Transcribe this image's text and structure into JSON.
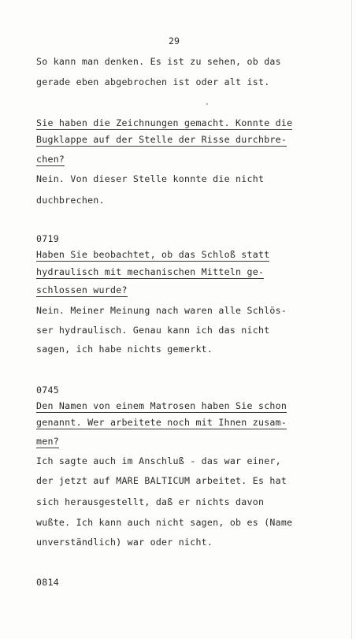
{
  "page_number": "29",
  "lines": [
    "So kann man denken. Es ist zu sehen, ob das",
    "gerade eben abgebrochen ist oder alt ist.",
    "Sie haben die Zeichnungen gemacht. Konnte die",
    "Bugklappe auf der Stelle der Risse durchbre-",
    "chen?",
    "Nein. Von dieser Stelle konnte die nicht",
    "duchbrechen.",
    "0719",
    "Haben Sie beobachtet, ob das Schloß statt",
    "hydraulisch mit mechanischen Mitteln ge-",
    "schlossen wurde?",
    "Nein. Meiner Meinung nach waren alle Schlös-",
    "ser hydraulisch. Genau kann ich das nicht",
    "sagen, ich habe nichts gemerkt.",
    "0745",
    "Den Namen von einem Matrosen haben Sie schon",
    "genannt. Wer arbeitete noch mit Ihnen zusam-",
    "men?",
    "Ich sagte auch im Anschluß - das war einer,",
    "der jetzt auf MARE BALTICUM arbeitet. Es hat",
    "sich herausgestellt, daß er nichts davon",
    "wußte. Ich kann auch nicht sagen, ob es (Name",
    "unverständlich) war oder nicht.",
    "0814"
  ]
}
